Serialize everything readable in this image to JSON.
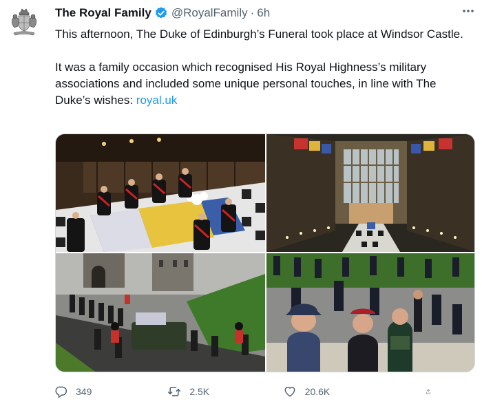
{
  "tweet": {
    "display_name": "The Royal Family",
    "handle": "@RoyalFamily",
    "separator": "·",
    "time": "6h",
    "paragraph_1": "This afternoon, The Duke of Edinburgh’s Funeral took place at Windsor Castle.",
    "paragraph_2": "It was a family occasion which recognised His Royal Highness’s military associations and included some unique personal touches, in line with The Duke’s wishes: ",
    "link_text": "royal.uk"
  },
  "icons": {
    "avatar": "royal-crest-icon",
    "verified": "verified-badge-icon",
    "more": "more-options-icon",
    "reply": "reply-icon",
    "retweet": "retweet-icon",
    "like": "like-icon",
    "share": "share-icon"
  },
  "actions": {
    "reply_count": "349",
    "retweet_count": "2.5K",
    "like_count": "20.6K"
  },
  "colors": {
    "accent": "#1d9bf0",
    "text": "#0f1419",
    "muted": "#536471"
  }
}
